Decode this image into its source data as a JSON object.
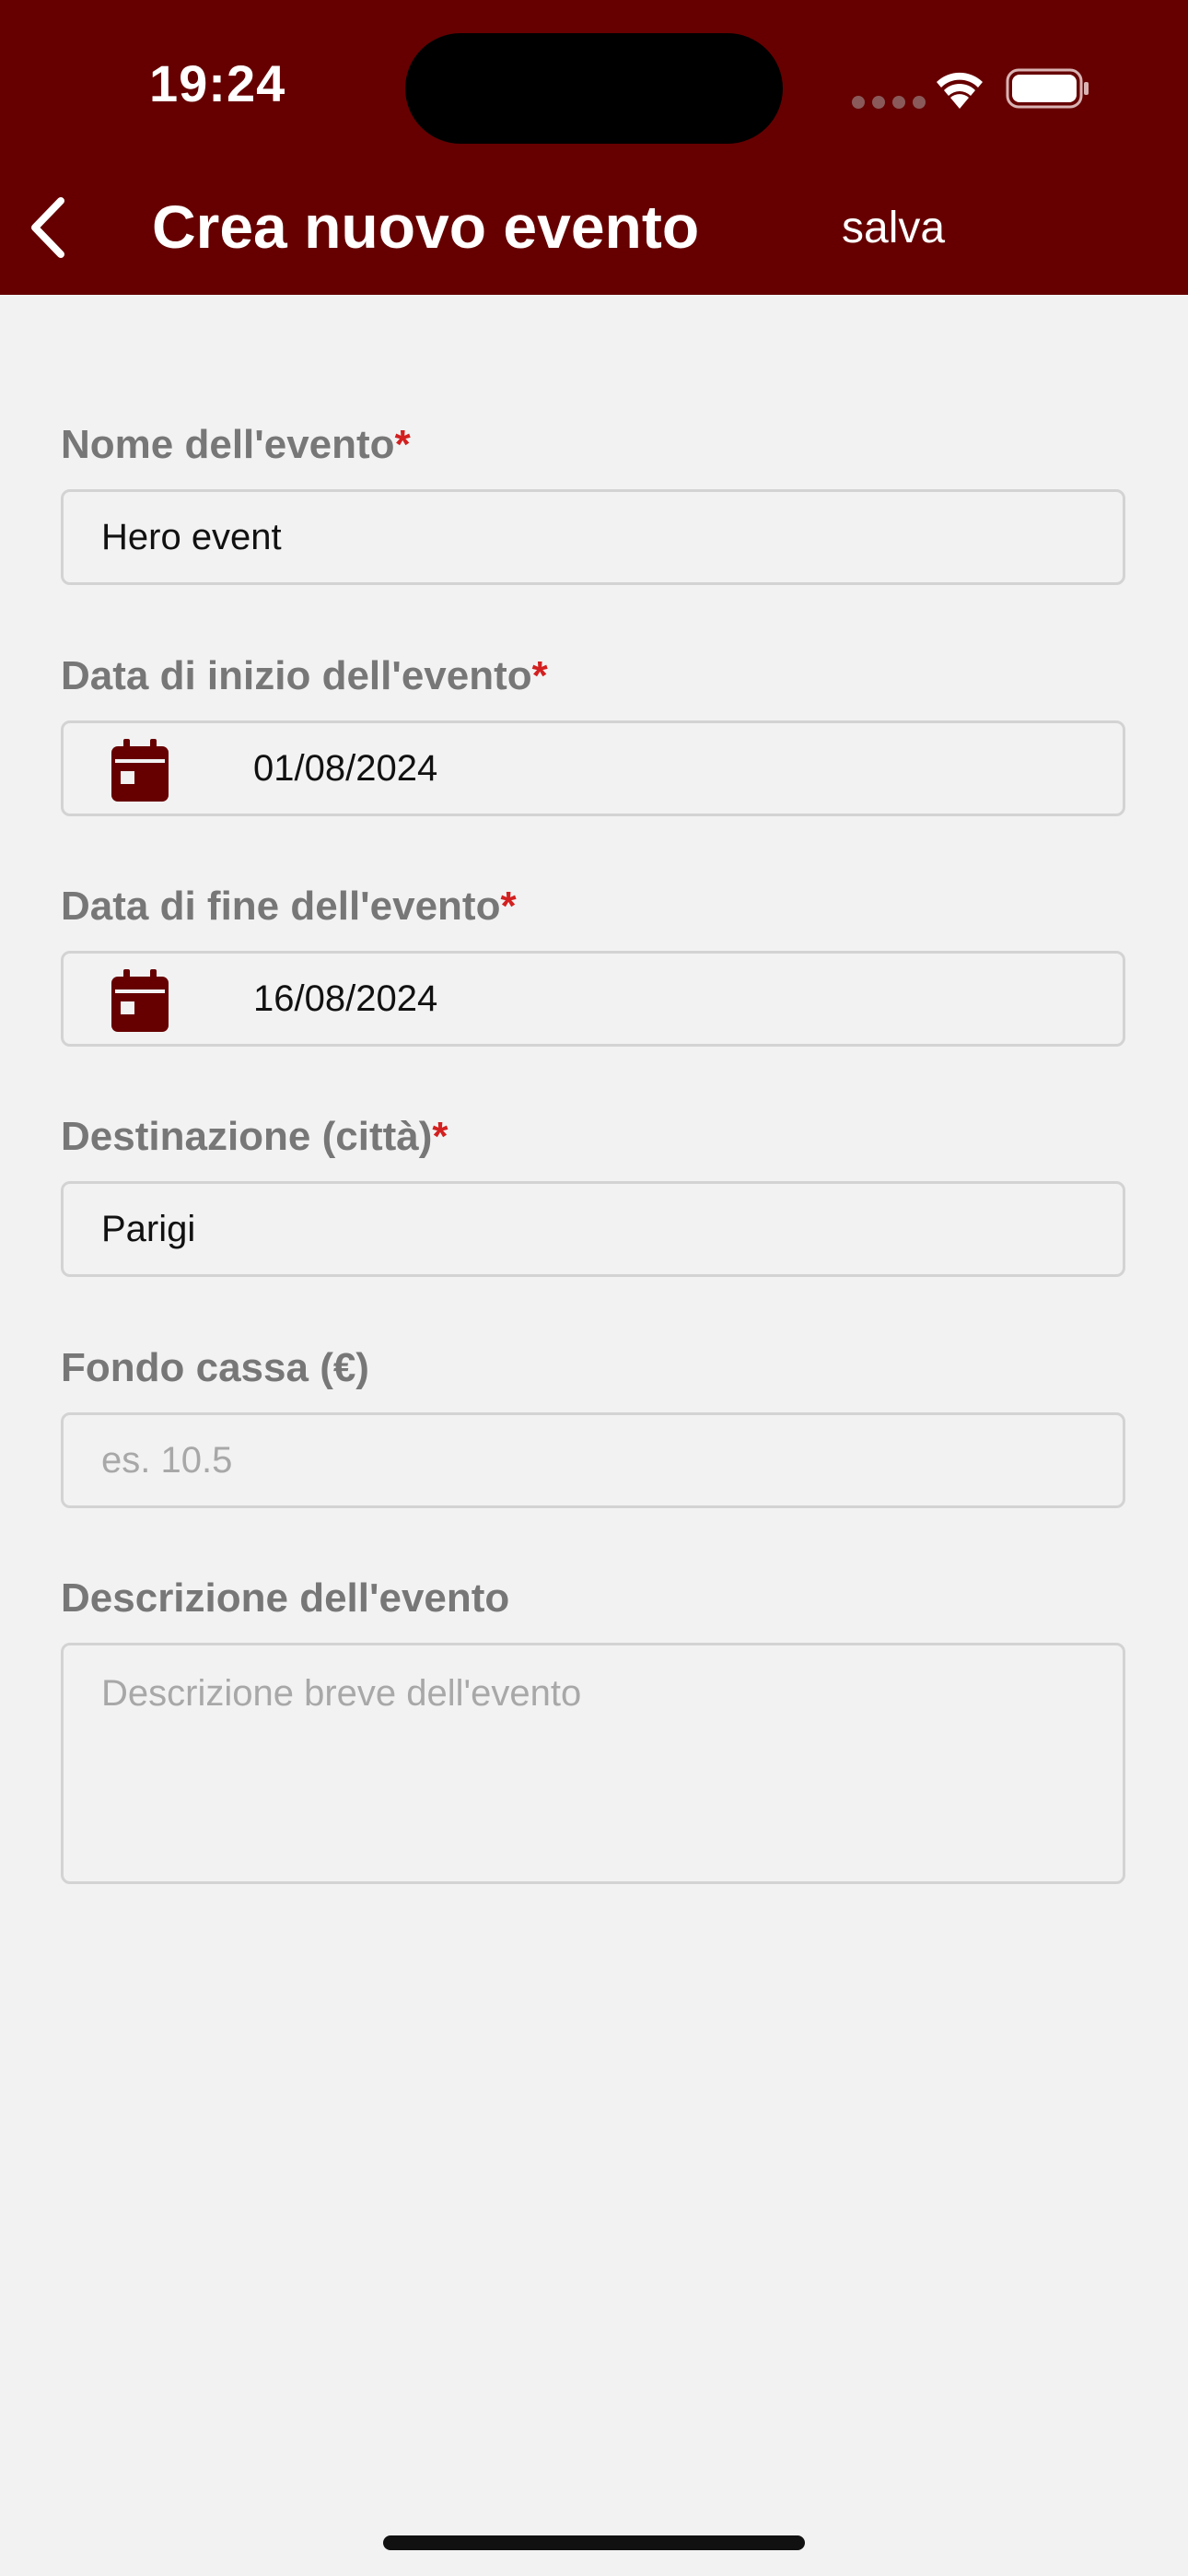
{
  "status_bar": {
    "time": "19:24"
  },
  "nav": {
    "title": "Crea nuovo evento",
    "save_label": "salva"
  },
  "form": {
    "required_mark": "*",
    "event_name": {
      "label": "Nome dell'evento",
      "required": true,
      "value": "Hero event"
    },
    "start_date": {
      "label": "Data di inizio dell'evento",
      "required": true,
      "value": "01/08/2024",
      "icon": "calendar-icon"
    },
    "end_date": {
      "label": "Data di fine dell'evento",
      "required": true,
      "value": "16/08/2024",
      "icon": "calendar-icon"
    },
    "destination": {
      "label": "Destinazione (città)",
      "required": true,
      "value": "Parigi"
    },
    "fund": {
      "label": "Fondo cassa (€)",
      "required": false,
      "value": "",
      "placeholder": "es. 10.5"
    },
    "description": {
      "label": "Descrizione dell'evento",
      "required": false,
      "value": "",
      "placeholder": "Descrizione breve dell'evento"
    }
  },
  "colors": {
    "header": "#660000",
    "accent": "#660000",
    "required": "#d32020",
    "background": "#f2f2f2"
  }
}
